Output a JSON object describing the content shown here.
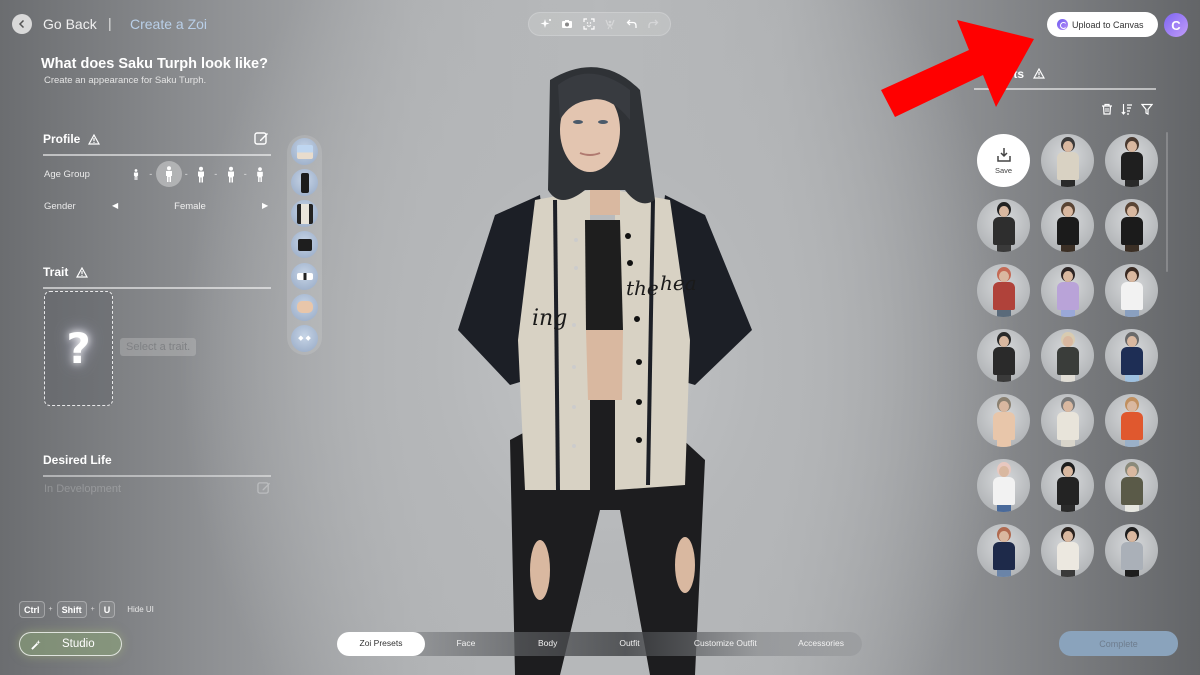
{
  "header": {
    "go_back_label": "Go Back",
    "separator": "|",
    "breadcrumb": "Create a Zoi"
  },
  "page": {
    "title": "What does Saku Turph look like?",
    "subtitle": "Create an appearance for Saku Turph."
  },
  "toolbar": {
    "tools": [
      "sparkle-icon",
      "camera-icon",
      "face-scan-icon",
      "pose-icon",
      "undo-icon",
      "redo-icon"
    ]
  },
  "top_right": {
    "upload_label": "Upload to Canvas",
    "avatar_letter": "C",
    "accent": "#7e66f2"
  },
  "profile": {
    "title": "Profile",
    "age_group_label": "Age Group",
    "age_groups": [
      "Child",
      "Teen",
      "Young Adult",
      "Adult",
      "Elder"
    ],
    "age_selected_index": 1,
    "gender_label": "Gender",
    "gender_prev": "◀",
    "gender_value": "Female",
    "gender_next": "▶"
  },
  "trait": {
    "title": "Trait",
    "placeholder_glyph": "?",
    "hint": "Select a trait."
  },
  "desired_life": {
    "title": "Desired Life",
    "status": "In Development"
  },
  "outfit_rail": {
    "items": [
      "top",
      "pants",
      "jacket",
      "shorts",
      "shoes",
      "nails",
      "earrings"
    ]
  },
  "presets": {
    "title": "sets",
    "save_label": "Save",
    "tools": [
      "trash-icon",
      "sort-icon",
      "filter-icon"
    ],
    "items": [
      {
        "top": "#d9d2c3",
        "hair": "#3b3a3a",
        "pants": "#2a2a2a"
      },
      {
        "top": "#1f1f1f",
        "hair": "#4a3a30",
        "pants": "#2a2a2a"
      },
      {
        "top": "#2e2e2e",
        "hair": "#222222",
        "pants": "#3a3a3a"
      },
      {
        "top": "#1b1b1b",
        "hair": "#5a4535",
        "pants": "#3b2f25"
      },
      {
        "top": "#1b1b1b",
        "hair": "#5a4535",
        "pants": "#3b2f25"
      },
      {
        "top": "#b0423a",
        "hair": "#c46a55",
        "pants": "#5a6a7a"
      },
      {
        "top": "#b9a3d8",
        "hair": "#2c2424",
        "pants": "#9aa8d8"
      },
      {
        "top": "#f2f2f2",
        "hair": "#3a2a22",
        "pants": "#8aa0c0"
      },
      {
        "top": "#2a2a2a",
        "hair": "#2a2a2a",
        "pants": "#3a3a3a"
      },
      {
        "top": "#3a3d3a",
        "hair": "#d8cbb0",
        "pants": "#e0ddd5"
      },
      {
        "top": "#1e2e55",
        "hair": "#6a6a6a",
        "pants": "#9ec0e0"
      },
      {
        "top": "#e8c6aa",
        "hair": "#8a8070",
        "pants": "#e8c6aa"
      },
      {
        "top": "#e8e4da",
        "hair": "#7a7a7a",
        "pants": "#d8d4ca"
      },
      {
        "top": "#e0582e",
        "hair": "#c09060",
        "pants": "#9ab0c8"
      },
      {
        "top": "#f2f2f2",
        "hair": "#e8c8c0",
        "pants": "#4a6a9a"
      },
      {
        "top": "#232323",
        "hair": "#1e1e1e",
        "pants": "#2a2a2a"
      },
      {
        "top": "#5a5a48",
        "hair": "#8a8a7a",
        "pants": "#e6e6e0"
      },
      {
        "top": "#1e2a4a",
        "hair": "#b06a50",
        "pants": "#6a84a8"
      },
      {
        "top": "#ece8e0",
        "hair": "#2a221e",
        "pants": "#3a3a3a"
      },
      {
        "top": "#aab0b8",
        "hair": "#1e1e1e",
        "pants": "#1e1e1e"
      }
    ]
  },
  "bottom": {
    "shortcut_keys": [
      "Ctrl",
      "Shift",
      "U"
    ],
    "shortcut_plus": "+",
    "shortcut_label": "Hide UI",
    "studio_label": "Studio",
    "tabs": [
      {
        "label": "Zoi Presets",
        "active": true
      },
      {
        "label": "Face",
        "active": false
      },
      {
        "label": "Body",
        "active": false
      },
      {
        "label": "Outfit",
        "active": false
      },
      {
        "label": "Customize Outfit",
        "active": false
      },
      {
        "label": "Accessories",
        "active": false
      }
    ],
    "complete_label": "Complete"
  },
  "annotation": {
    "arrow_color": "#ff0000",
    "points_to": "Upload to Canvas"
  }
}
